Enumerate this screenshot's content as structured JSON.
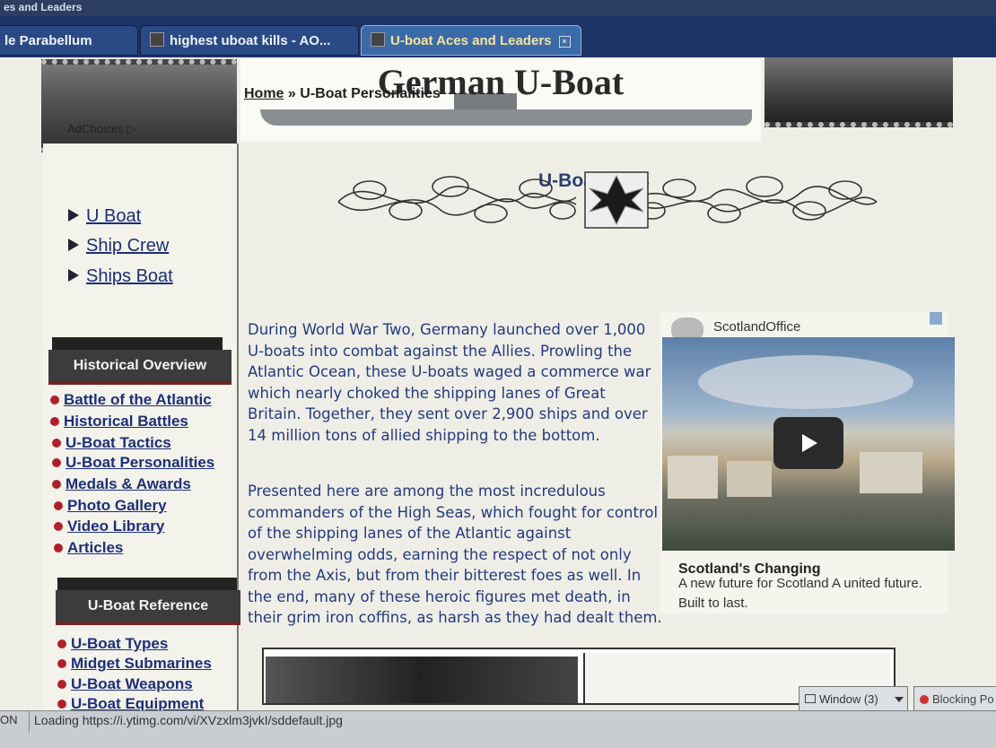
{
  "window": {
    "title_fragment": "es and Leaders"
  },
  "tabs": [
    {
      "label": "le Parabellum",
      "active": false
    },
    {
      "label": "highest uboat kills - AO...",
      "active": false
    },
    {
      "label": "U-boat Aces and Leaders",
      "active": true
    }
  ],
  "banner": {
    "title": "German U-Boat"
  },
  "breadcrumb": {
    "home": "Home",
    "separator": "»",
    "current": "U-Boat Personalities"
  },
  "page_title": "U-Boat Aces",
  "sidebar": {
    "adchoices": "AdChoices",
    "ad_links": [
      "U Boat",
      "Ship Crew",
      "Ships Boat"
    ],
    "sections": [
      {
        "title": "Historical Overview",
        "links": [
          "Battle of the Atlantic",
          "Historical Battles",
          "U-Boat Tactics",
          "U-Boat Personalities",
          "Medals & Awards",
          "Photo Gallery",
          "Video Library",
          "Articles"
        ]
      },
      {
        "title": "U-Boat Reference",
        "links": [
          "U-Boat Types",
          "Midget Submarines",
          "U-Boat Weapons",
          "U-Boat Equipment"
        ]
      }
    ]
  },
  "content": {
    "paragraphs": [
      "During World War Two, Germany launched over 1,000 U-boats into combat against the Allies. Prowling the Atlantic Ocean, these U-boats waged a commerce war which nearly choked the shipping lanes of Great Britain. Together, they sent over 2,900 ships and over 14 million tons of allied shipping to the bottom.",
      "Presented here are among the most incredulous commanders of the High Seas, which fought for control of the shipping lanes of the Atlantic against overwhelming odds, earning the respect of not only from the Axis, but from their bitterest foes as well. In the end, many of these heroic figures met death, in their grim iron coffins, as harsh as they had dealt them."
    ]
  },
  "ad": {
    "sponsor": "ScotlandOffice",
    "headline": "Scotland's Changing",
    "description": "A new future for Scotland A united future. Built to last."
  },
  "statusbar": {
    "left": "ON",
    "loading_text": "Loading https://i.ytimg.com/vi/XVzxlm3jvkI/sddefault.jpg",
    "window_button": "Window (3)",
    "blocking_button": "Blocking Po"
  },
  "colors": {
    "link": "#1d2f78",
    "bullet": "#b0202a",
    "tab_bar": "#1d3566"
  }
}
